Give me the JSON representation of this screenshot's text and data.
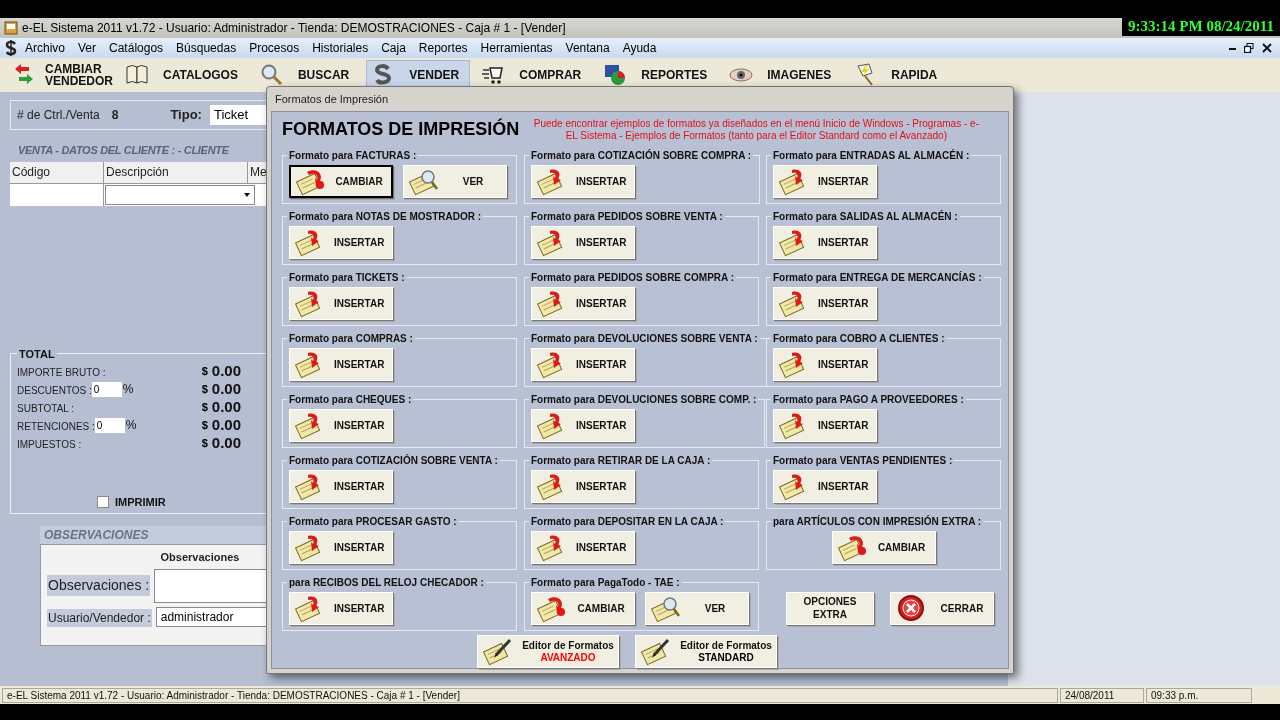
{
  "clock": "9:33:14 PM 08/24/2011",
  "window": {
    "title": "e-EL Sistema 2011 v1.72 - Usuario: Administrador - Tienda: DEMOSTRACIONES - Caja # 1 - [Vender]"
  },
  "menu": [
    "Archivo",
    "Ver",
    "Catálogos",
    "Búsquedas",
    "Procesos",
    "Historiales",
    "Caja",
    "Reportes",
    "Herramientas",
    "Ventana",
    "Ayuda"
  ],
  "toolbar": [
    {
      "kind": "switch-user",
      "label": "CAMBIAR VENDEDOR",
      "selected": false
    },
    {
      "kind": "catalog",
      "label": "CATALOGOS",
      "selected": false
    },
    {
      "kind": "search",
      "label": "BUSCAR",
      "selected": false
    },
    {
      "kind": "sell",
      "label": "VENDER",
      "selected": true
    },
    {
      "kind": "buy",
      "label": "COMPRAR",
      "selected": false
    },
    {
      "kind": "reports",
      "label": "REPORTES",
      "selected": false
    },
    {
      "kind": "images",
      "label": "IMAGENES",
      "selected": false
    },
    {
      "kind": "quick",
      "label": "RAPIDA",
      "selected": false
    }
  ],
  "sale_form": {
    "ctrl_label": "# de Ctrl./Venta",
    "ctrl_value": "8",
    "tipo_label": "Tipo:",
    "tipo_value": "Ticket",
    "section_title": "VENTA - DATOS DEL CLIENTE : - CLIENTE",
    "columns": [
      "Código",
      "Descripción",
      "Me"
    ]
  },
  "totals": {
    "title": "TOTAL",
    "rows": [
      {
        "label": "IMPORTE BRUTO :",
        "currency": "$",
        "value": "0.00"
      },
      {
        "label": "DESCUENTOS :",
        "input": "0",
        "unit": "%",
        "currency": "$",
        "value": "0.00"
      },
      {
        "label": "SUBTOTAL :",
        "currency": "$",
        "value": "0.00"
      },
      {
        "label": "RETENCIONES :",
        "input": "0",
        "unit": "%",
        "currency": "$",
        "value": "0.00"
      },
      {
        "label": "IMPUESTOS :",
        "currency": "$",
        "value": "0.00"
      }
    ],
    "print": {
      "label": "IMPRIMIR",
      "checked": false
    }
  },
  "observations": {
    "title": "OBSERVACIONES",
    "header": "Observaciones",
    "fields": [
      {
        "label": "Observaciones :",
        "multiline": true
      },
      {
        "label": "Usuario/Vendedor :",
        "value": "administrador",
        "multiline": false
      }
    ]
  },
  "dialog": {
    "title": "Formatos de Impresión",
    "heading": "FORMATOS DE IMPRESIÓN",
    "note": "Puede encontrar ejemplos de formatos ya diseñados en el menú Inicio de Windows - Programas - e-EL Sistema - Ejemplos de Formatos (tanto para el Editor Standard como el Avanzado)",
    "groups": [
      {
        "title": "Formato para FACTURAS :",
        "buttons": [
          {
            "kind": "change",
            "label": "CAMBIAR",
            "focused": true
          },
          {
            "kind": "view",
            "label": "VER",
            "focused": false
          }
        ]
      },
      {
        "title": "Formato para COTIZACIÓN SOBRE COMPRA :",
        "buttons": [
          {
            "kind": "insert",
            "label": "INSERTAR",
            "focused": false
          }
        ]
      },
      {
        "title": "Formato para ENTRADAS AL ALMACÉN :",
        "buttons": [
          {
            "kind": "insert",
            "label": "INSERTAR",
            "focused": false
          }
        ]
      },
      {
        "title": "Formato para NOTAS DE MOSTRADOR :",
        "buttons": [
          {
            "kind": "insert",
            "label": "INSERTAR",
            "focused": false
          }
        ]
      },
      {
        "title": "Formato para PEDIDOS SOBRE VENTA :",
        "buttons": [
          {
            "kind": "insert",
            "label": "INSERTAR",
            "focused": false
          }
        ]
      },
      {
        "title": "Formato para SALIDAS AL ALMACÉN :",
        "buttons": [
          {
            "kind": "insert",
            "label": "INSERTAR",
            "focused": false
          }
        ]
      },
      {
        "title": "Formato para TICKETS :",
        "buttons": [
          {
            "kind": "insert",
            "label": "INSERTAR",
            "focused": false
          }
        ]
      },
      {
        "title": "Formato para PEDIDOS SOBRE COMPRA :",
        "buttons": [
          {
            "kind": "insert",
            "label": "INSERTAR",
            "focused": false
          }
        ]
      },
      {
        "title": "Formato para ENTREGA DE MERCANCÍAS :",
        "buttons": [
          {
            "kind": "insert",
            "label": "INSERTAR",
            "focused": false
          }
        ]
      },
      {
        "title": "Formato para COMPRAS :",
        "buttons": [
          {
            "kind": "insert",
            "label": "INSERTAR",
            "focused": false
          }
        ]
      },
      {
        "title": "Formato para DEVOLUCIONES SOBRE VENTA :",
        "buttons": [
          {
            "kind": "insert",
            "label": "INSERTAR",
            "focused": false
          }
        ]
      },
      {
        "title": "Formato para COBRO A CLIENTES :",
        "buttons": [
          {
            "kind": "insert",
            "label": "INSERTAR",
            "focused": false
          }
        ]
      },
      {
        "title": "Formato para CHEQUES :",
        "buttons": [
          {
            "kind": "insert",
            "label": "INSERTAR",
            "focused": false
          }
        ]
      },
      {
        "title": "Formato para DEVOLUCIONES SOBRE COMP. :",
        "buttons": [
          {
            "kind": "insert",
            "label": "INSERTAR",
            "focused": false
          }
        ]
      },
      {
        "title": "Formato para PAGO A PROVEEDORES :",
        "buttons": [
          {
            "kind": "insert",
            "label": "INSERTAR",
            "focused": false
          }
        ]
      },
      {
        "title": "Formato para COTIZACIÓN SOBRE VENTA :",
        "buttons": [
          {
            "kind": "insert",
            "label": "INSERTAR",
            "focused": false
          }
        ]
      },
      {
        "title": "Formato para RETIRAR DE LA CAJA :",
        "buttons": [
          {
            "kind": "insert",
            "label": "INSERTAR",
            "focused": false
          }
        ]
      },
      {
        "title": "Formato para VENTAS PENDIENTES :",
        "buttons": [
          {
            "kind": "insert",
            "label": "INSERTAR",
            "focused": false
          }
        ]
      },
      {
        "title": "Formato para PROCESAR GASTO :",
        "buttons": [
          {
            "kind": "insert",
            "label": "INSERTAR",
            "focused": false
          }
        ]
      },
      {
        "title": "Formato para DEPOSITAR EN LA CAJA :",
        "buttons": [
          {
            "kind": "insert",
            "label": "INSERTAR",
            "focused": false
          }
        ]
      },
      {
        "title": "para ARTÍCULOS CON IMPRESIÓN EXTRA :",
        "centered": true,
        "buttons": [
          {
            "kind": "change",
            "label": "CAMBIAR",
            "focused": false
          }
        ]
      },
      {
        "title": "para RECIBOS DEL RELOJ CHECADOR :",
        "buttons": [
          {
            "kind": "insert",
            "label": "INSERTAR",
            "focused": false
          }
        ]
      },
      {
        "title": "Formato para PagaTodo - TAE :",
        "buttons": [
          {
            "kind": "change",
            "label": "CAMBIAR",
            "focused": false
          },
          {
            "kind": "view",
            "label": "VER",
            "focused": false
          }
        ]
      }
    ],
    "actions": [
      {
        "kind": "text",
        "label": "OPCIONES EXTRA"
      },
      {
        "kind": "close",
        "label": "CERRAR"
      }
    ],
    "editors": [
      {
        "label": "Editor de Formatos",
        "sublabel": "AVANZADO",
        "color": "#ff0000"
      },
      {
        "label": "Editor de Formatos",
        "sublabel": "STANDARD",
        "color": "#000000"
      }
    ]
  },
  "status_bar": [
    "e-EL Sistema 2011 v1.72 - Usuario: Administrador - Tienda: DEMOSTRACIONES - Caja # 1 - [Vender]",
    "24/08/2011",
    "09:33 p.m."
  ]
}
